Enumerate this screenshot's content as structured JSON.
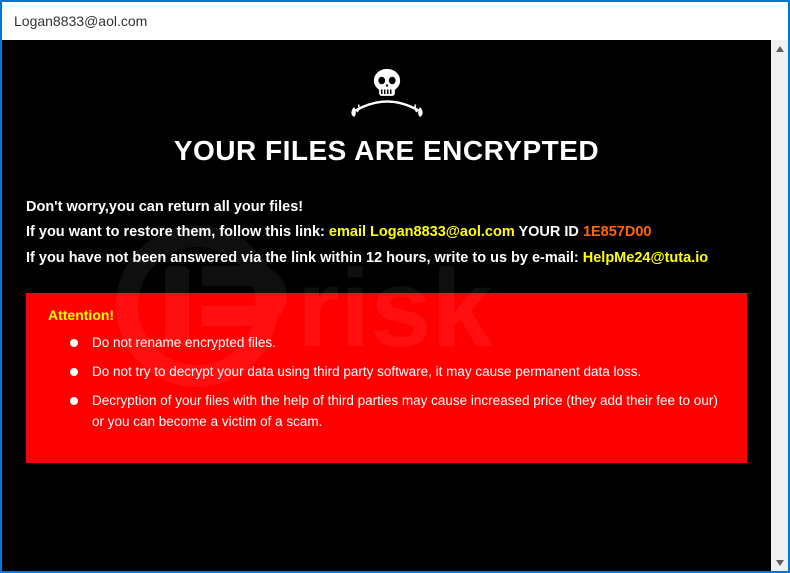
{
  "window": {
    "title": "Logan8833@aol.com"
  },
  "headline": "YOUR FILES ARE ENCRYPTED",
  "message": {
    "line1": "Don't worry,you can return all your files!",
    "line2_a": "If you want to restore them, follow this link: ",
    "line2_email_label": "email ",
    "line2_email": "Logan8833@aol.com",
    "line2_b": "  YOUR ID ",
    "line2_id": "1E857D00",
    "line3_a": "If you have not been answered via the link within 12 hours, write to us by e-mail: ",
    "line3_email": "HelpMe24@tuta.io"
  },
  "alert": {
    "title": "Attention!",
    "items": [
      "Do not rename encrypted files.",
      "Do not try to decrypt your data using third party software, it may cause permanent data loss.",
      "Decryption of your files with the help of third parties may cause increased price (they add their fee to our) or you can become a victim of a scam."
    ]
  }
}
